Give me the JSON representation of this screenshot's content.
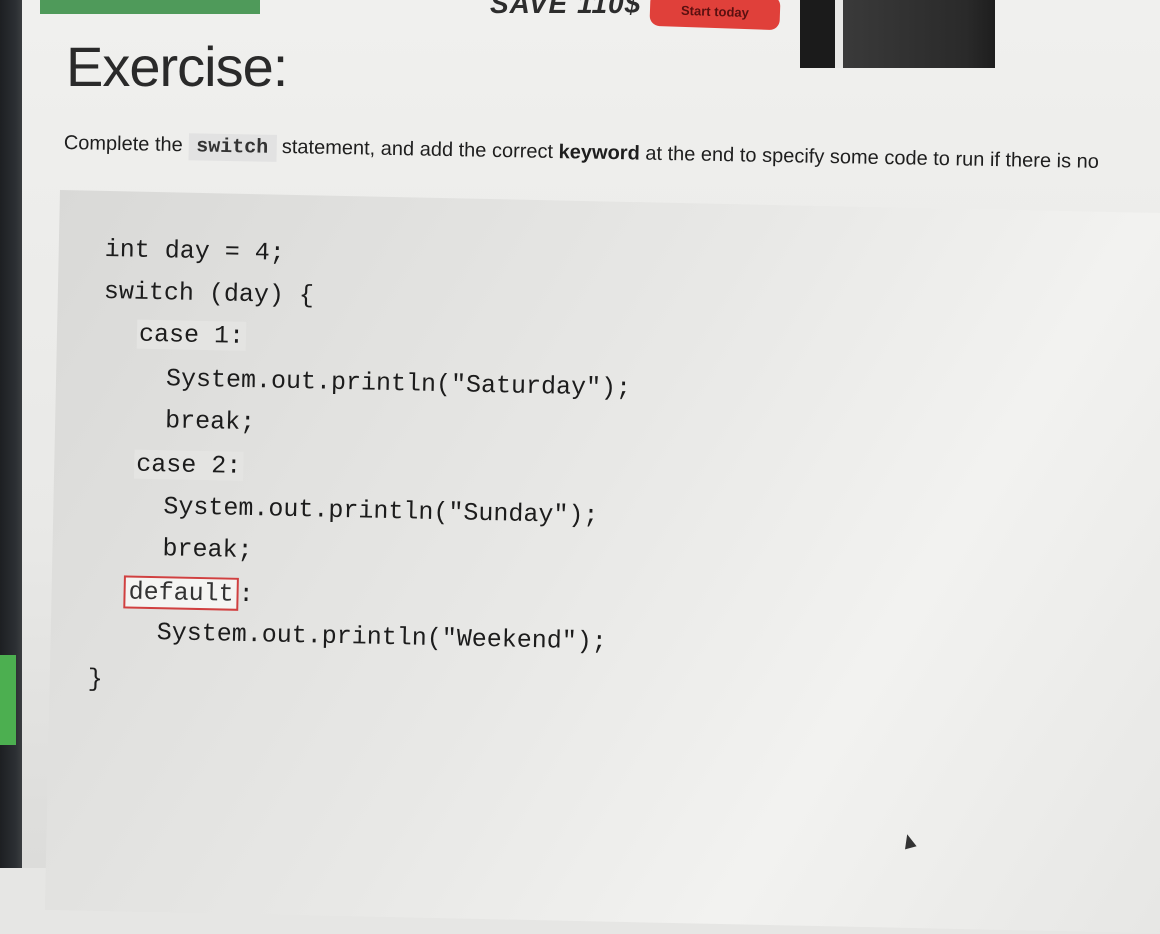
{
  "banner": {
    "save_text": "SAVE 110$",
    "start_button_label": "Start today"
  },
  "exercise": {
    "title": "Exercise:",
    "instruction": {
      "part1": "Complete the ",
      "code_word": "switch",
      "part2": " statement, and add the correct ",
      "keyword": "keyword",
      "part3": " at the end to specify some code to run if there is no"
    }
  },
  "code": {
    "line1": "int day = 4;",
    "line2": "switch (day) {",
    "case1": "case 1:",
    "print1": "System.out.println(\"Saturday\");",
    "break1": "break;",
    "case2": "case 2:",
    "print2": "System.out.println(\"Sunday\");",
    "break2": "break;",
    "answer_value": "default",
    "answer_suffix": ":",
    "print3": "System.out.println(\"Weekend\");",
    "closing": "}"
  }
}
